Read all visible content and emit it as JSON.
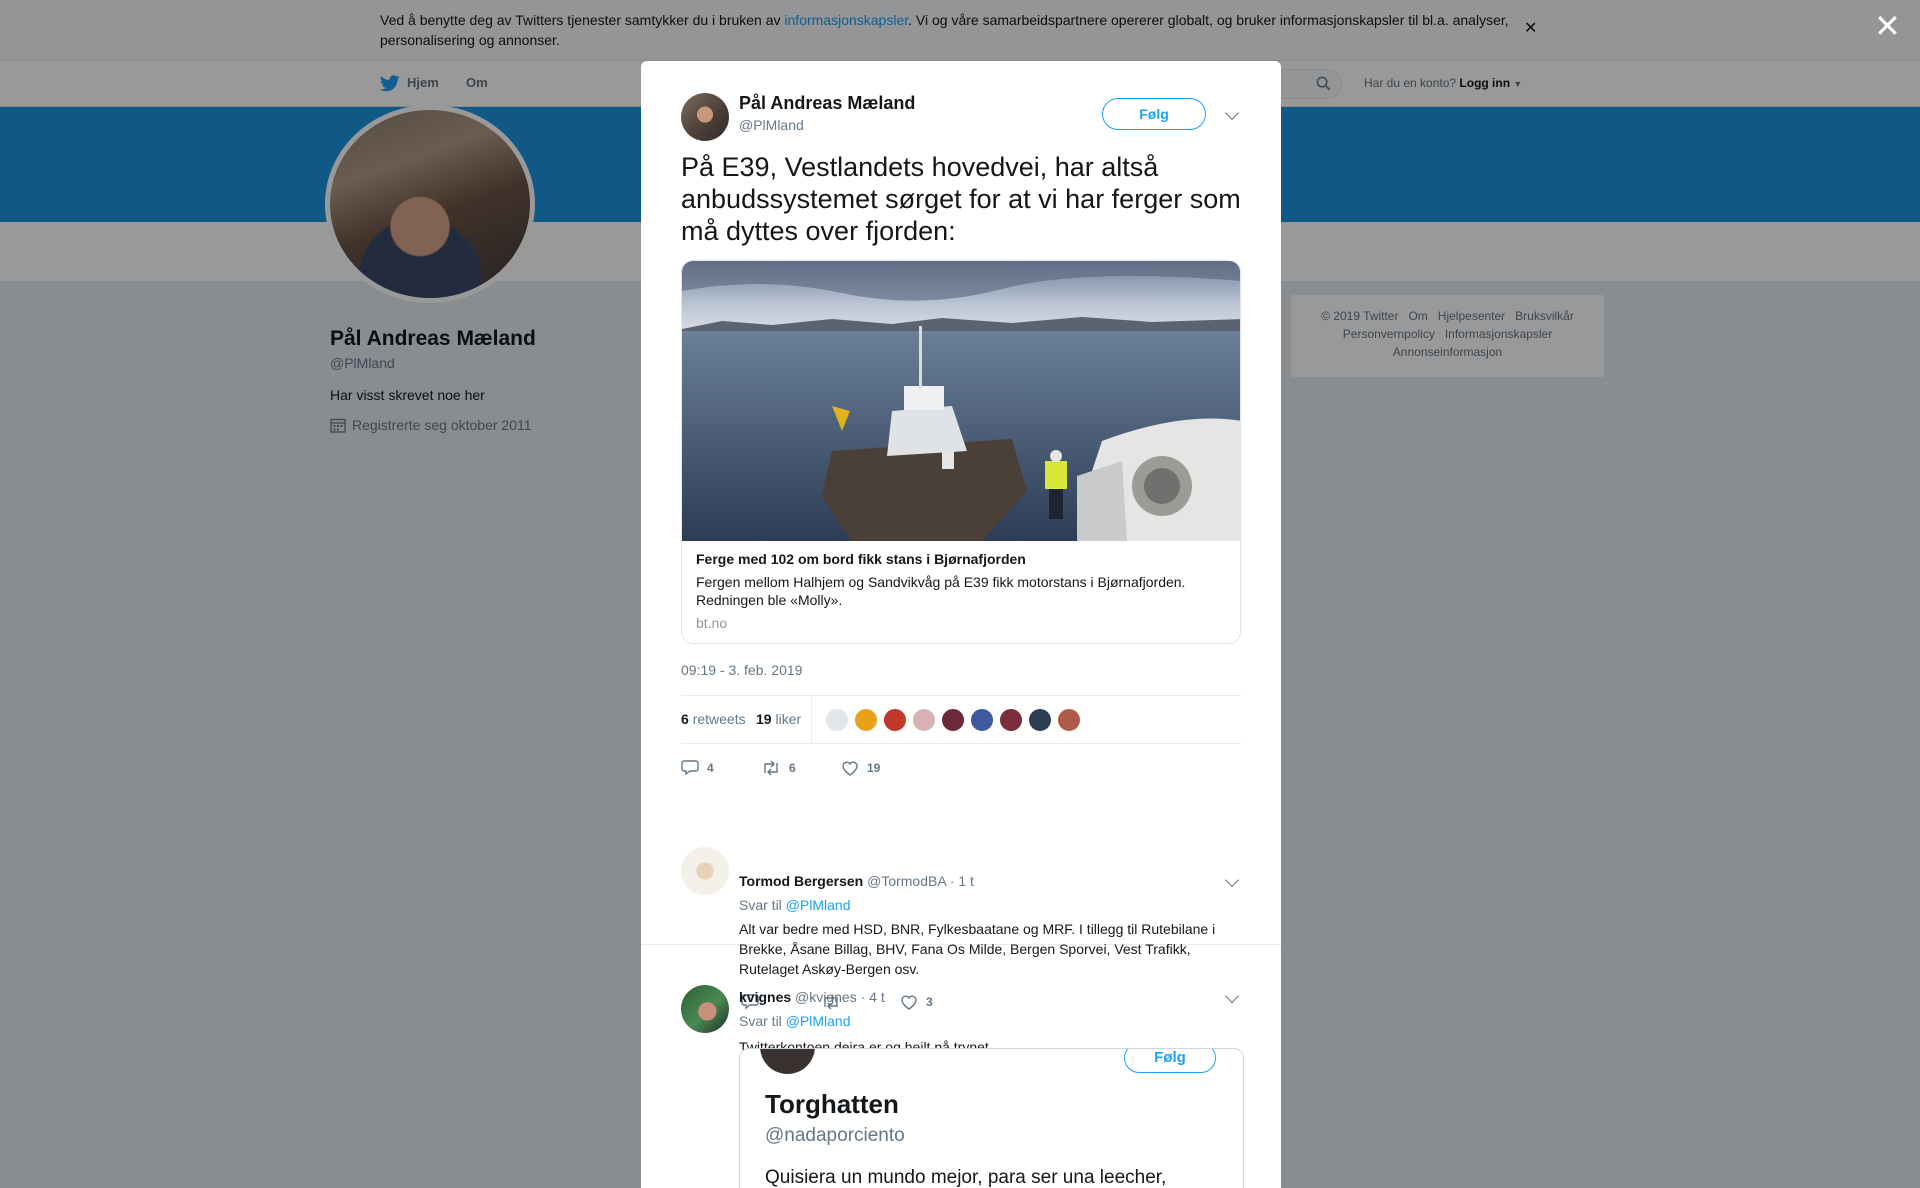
{
  "cookie_banner": {
    "text_before": "Ved å benytte deg av Twitters tjenester samtykker du i bruken av ",
    "link": "informasjonskapsler",
    "text_after": ". Vi og våre samarbeidspartnere opererer globalt, og bruker informasjonskapsler til bl.a. analyser, personalisering og annonser."
  },
  "topnav": {
    "home_label": "Hjem",
    "about_label": "Om",
    "account_prompt": "Har du en konto?",
    "login_label": "Logg inn"
  },
  "profile": {
    "name": "Pål Andreas Mæland",
    "handle": "@PlMland",
    "bio": "Har visst skrevet noe her",
    "joined": "Registrerte seg oktober 2011"
  },
  "footer": {
    "links": [
      "© 2019 Twitter",
      "Om",
      "Hjelpesenter",
      "Bruksvilkår",
      "Personvernpolicy",
      "Informasjonskapsler",
      "Annonseinformasjon"
    ]
  },
  "tweet": {
    "author_name": "Pål Andreas Mæland",
    "author_handle": "@PlMland",
    "follow_label": "Følg",
    "text": "På E39, Vestlandets hovedvei, har altså anbudssystemet sørget for at vi har ferger som må dyttes over fjorden:",
    "card": {
      "title": "Ferge med 102 om bord fikk stans i Bjørnafjorden",
      "description": "Fergen mellom Halhjem og Sandvikvåg på E39 fikk motorstans i Bjørnafjorden. Redningen ble «Molly».",
      "domain": "bt.no"
    },
    "timestamp": "09:19 - 3. feb. 2019",
    "retweets_count": "6",
    "retweets_label": "retweets",
    "likes_count": "19",
    "likes_label": "liker",
    "reply_count": "4",
    "retweet_count": "6",
    "like_count": "19",
    "liker_avatar_colors": [
      "#dfe6ec",
      "#e8a21a",
      "#c0392b",
      "#d9b3b3",
      "#6b2a3a",
      "#3d5a9e",
      "#7a2f3b",
      "#2c3e50",
      "#b05a4a"
    ]
  },
  "replies": [
    {
      "name": "Tormod Bergersen",
      "handle": "@TormodBA",
      "time": "· 1 t",
      "reply_to_label": "Svar til",
      "reply_to_handle": "@PlMland",
      "text": "Alt var bedre med HSD, BNR, Fylkesbaatane og MRF. I tillegg til Rutebilane i Brekke, Åsane Billag, BHV, Fana Os Milde, Bergen Sporvei, Vest Trafikk, Rutelaget Askøy-Bergen osv.",
      "reply_count": "",
      "retweet_count": "",
      "like_count": "3"
    },
    {
      "name": "kvignes",
      "handle": "@kvignes",
      "time": "· 4 t",
      "reply_to_label": "Svar til",
      "reply_to_handle": "@PlMland",
      "text": "Twitterkontoen deira er og heilt på trynet.",
      "embedded": {
        "follow_label": "Følg",
        "name": "Torghatten",
        "handle": "@nadaporciento",
        "text": "Quisiera un mundo mejor, para ser una leecher,"
      }
    }
  ]
}
